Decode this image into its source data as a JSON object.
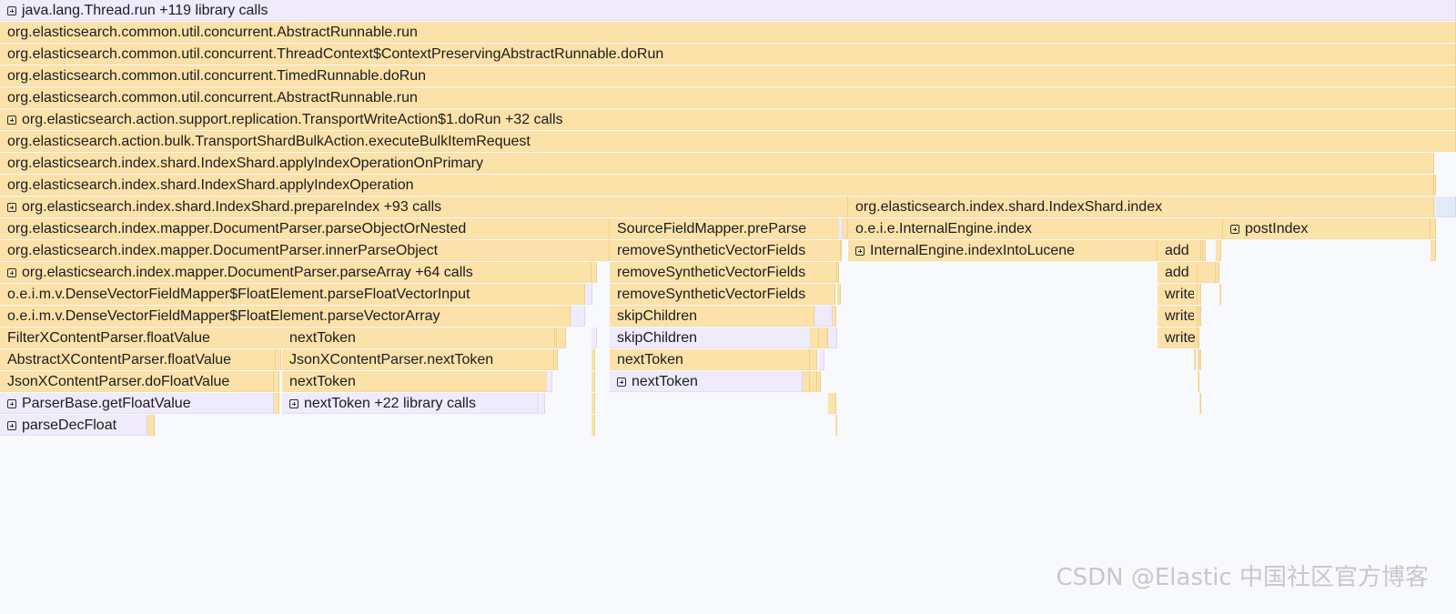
{
  "flamegraph": {
    "frames": [
      {
        "label": "java.lang.Thread.run",
        "suffix": "+119 library calls",
        "expandable": true,
        "color": "purple",
        "interactive": true
      },
      {
        "label": "org.elasticsearch.common.util.concurrent.AbstractRunnable.run",
        "color": "yellow",
        "interactive": true
      },
      {
        "label": "org.elasticsearch.common.util.concurrent.ThreadContext$ContextPreservingAbstractRunnable.doRun",
        "color": "yellow",
        "interactive": true
      },
      {
        "label": "org.elasticsearch.common.util.concurrent.TimedRunnable.doRun",
        "color": "yellow",
        "interactive": true
      },
      {
        "label": "org.elasticsearch.common.util.concurrent.AbstractRunnable.run",
        "color": "yellow",
        "interactive": true
      },
      {
        "label": "org.elasticsearch.action.support.replication.TransportWriteAction$1.doRun",
        "suffix": "+32 calls",
        "expandable": true,
        "color": "yellow",
        "interactive": true
      },
      {
        "label": "org.elasticsearch.action.bulk.TransportShardBulkAction.executeBulkItemRequest",
        "color": "yellow",
        "interactive": true
      },
      {
        "label": "org.elasticsearch.index.shard.IndexShard.applyIndexOperationOnPrimary",
        "color": "yellow",
        "interactive": true
      },
      {
        "label": "org.elasticsearch.index.shard.IndexShard.applyIndexOperation",
        "color": "yellow",
        "interactive": true
      },
      {
        "label": "org.elasticsearch.index.shard.IndexShard.prepareIndex",
        "suffix": "+93 calls",
        "expandable": true,
        "color": "yellow",
        "interactive": true
      },
      {
        "label": "org.elasticsearch.index.shard.IndexShard.index",
        "color": "yellow",
        "interactive": true
      },
      {
        "label": "org.elasticsearch.index.mapper.DocumentParser.parseObjectOrNested",
        "color": "yellow",
        "interactive": true
      },
      {
        "label": "SourceFieldMapper.preParse",
        "color": "yellow",
        "interactive": true
      },
      {
        "label": "o.e.i.e.InternalEngine.index",
        "color": "yellow",
        "interactive": true
      },
      {
        "label": "postIndex",
        "expandable": true,
        "color": "yellow",
        "interactive": true
      },
      {
        "label": "org.elasticsearch.index.mapper.DocumentParser.innerParseObject",
        "color": "yellow",
        "interactive": true
      },
      {
        "label": "removeSyntheticVectorFields",
        "color": "yellow",
        "interactive": true
      },
      {
        "label": "InternalEngine.indexIntoLucene",
        "expandable": true,
        "color": "yellow",
        "interactive": true
      },
      {
        "label": "add",
        "color": "yellow",
        "interactive": true
      },
      {
        "label": "org.elasticsearch.index.mapper.DocumentParser.parseArray",
        "suffix": "+64 calls",
        "expandable": true,
        "color": "yellow",
        "interactive": true
      },
      {
        "label": "removeSyntheticVectorFields",
        "color": "yellow",
        "interactive": true
      },
      {
        "label": "add",
        "color": "yellow",
        "interactive": true
      },
      {
        "label": "o.e.i.m.v.DenseVectorFieldMapper$FloatElement.parseFloatVectorInput",
        "color": "yellow",
        "interactive": true
      },
      {
        "label": "removeSyntheticVectorFields",
        "color": "yellow",
        "interactive": true
      },
      {
        "label": "write",
        "color": "yellow",
        "interactive": true
      },
      {
        "label": "o.e.i.m.v.DenseVectorFieldMapper$FloatElement.parseVectorArray",
        "color": "yellow",
        "interactive": true
      },
      {
        "label": "skipChildren",
        "color": "yellow",
        "interactive": true
      },
      {
        "label": "write",
        "color": "yellow",
        "interactive": true
      },
      {
        "label": "FilterXContentParser.floatValue",
        "color": "yellow",
        "interactive": true
      },
      {
        "label": "nextToken",
        "color": "yellow",
        "interactive": true
      },
      {
        "label": "skipChildren",
        "color": "purple",
        "interactive": true
      },
      {
        "label": "write",
        "color": "yellow",
        "interactive": true
      },
      {
        "label": "AbstractXContentParser.floatValue",
        "color": "yellow",
        "interactive": true
      },
      {
        "label": "JsonXContentParser.nextToken",
        "color": "yellow",
        "interactive": true
      },
      {
        "label": "nextToken",
        "color": "yellow",
        "interactive": true
      },
      {
        "label": "JsonXContentParser.doFloatValue",
        "color": "yellow",
        "interactive": true
      },
      {
        "label": "nextToken",
        "color": "yellow",
        "interactive": true
      },
      {
        "label": "nextToken",
        "expandable": true,
        "color": "purple",
        "interactive": true
      },
      {
        "label": "ParserBase.getFloatValue",
        "expandable": true,
        "color": "purple",
        "interactive": true
      },
      {
        "label": "nextToken",
        "suffix": "+22 library calls",
        "expandable": true,
        "color": "purple",
        "interactive": true
      },
      {
        "label": "parseDecFloat",
        "expandable": true,
        "color": "purple",
        "interactive": true
      },
      {
        "label": "",
        "color": "purple"
      },
      {
        "label": "",
        "color": "purple"
      },
      {
        "label": "",
        "color": "yellow"
      },
      {
        "label": "",
        "color": "yellow"
      },
      {
        "label": "",
        "color": "yellow"
      },
      {
        "label": "",
        "color": "purple"
      },
      {
        "label": "",
        "color": "purple"
      },
      {
        "label": "",
        "color": "yellow"
      },
      {
        "label": "",
        "color": "yellow"
      },
      {
        "label": "",
        "color": "yellow"
      },
      {
        "label": "",
        "color": "yellow"
      },
      {
        "label": "",
        "color": "purple"
      },
      {
        "label": "",
        "color": "yellow"
      },
      {
        "label": "",
        "color": "yellow"
      },
      {
        "label": "",
        "color": "yellow"
      },
      {
        "label": "",
        "color": "yellow"
      },
      {
        "label": "",
        "color": "purple"
      },
      {
        "label": "",
        "color": "yellow"
      },
      {
        "label": "",
        "color": "yellow"
      },
      {
        "label": "",
        "color": "yellow"
      },
      {
        "label": "",
        "color": "yellow"
      },
      {
        "label": "",
        "color": "purple"
      },
      {
        "label": "",
        "color": "yellow"
      },
      {
        "label": "",
        "color": "yellow"
      },
      {
        "label": "",
        "color": "yellow"
      },
      {
        "label": "",
        "color": "yellow"
      },
      {
        "label": "",
        "color": "yellow"
      },
      {
        "label": "",
        "color": "yellow"
      },
      {
        "label": "",
        "color": "yellow"
      },
      {
        "label": "",
        "color": "yellow"
      },
      {
        "label": "",
        "color": "purple"
      },
      {
        "label": "",
        "color": "yellow"
      },
      {
        "label": "",
        "color": "yellow"
      },
      {
        "label": "",
        "color": "yellow"
      },
      {
        "label": "",
        "color": "yellow"
      },
      {
        "label": "",
        "color": "yellow"
      },
      {
        "label": "",
        "color": "yellow"
      },
      {
        "label": "",
        "color": "yellow"
      },
      {
        "label": "",
        "color": "yellow"
      },
      {
        "label": "",
        "color": "yellow"
      },
      {
        "label": "",
        "color": "yellow"
      },
      {
        "label": "",
        "color": "yellow"
      },
      {
        "label": "",
        "color": "yellow"
      },
      {
        "label": "",
        "color": "yellow"
      },
      {
        "label": "",
        "color": "yellow"
      },
      {
        "label": "",
        "color": "yellow"
      },
      {
        "label": "",
        "color": "yellow"
      },
      {
        "label": "",
        "color": "yellow"
      },
      {
        "label": "",
        "color": "yellow"
      },
      {
        "label": "",
        "color": "yellow"
      },
      {
        "label": "",
        "color": "yellow"
      },
      {
        "label": "",
        "color": "yellow"
      },
      {
        "label": "",
        "color": "yellow"
      },
      {
        "label": "",
        "color": "purple"
      },
      {
        "label": "",
        "color": "blue"
      },
      {
        "label": "",
        "color": "blue"
      }
    ]
  },
  "watermark": "CSDN @Elastic 中国社区官方博客",
  "colors": {
    "yellow": "#fce2a9",
    "purple": "#efeafc",
    "blue": "#e3eaf8",
    "background": "#f8f9fc"
  }
}
